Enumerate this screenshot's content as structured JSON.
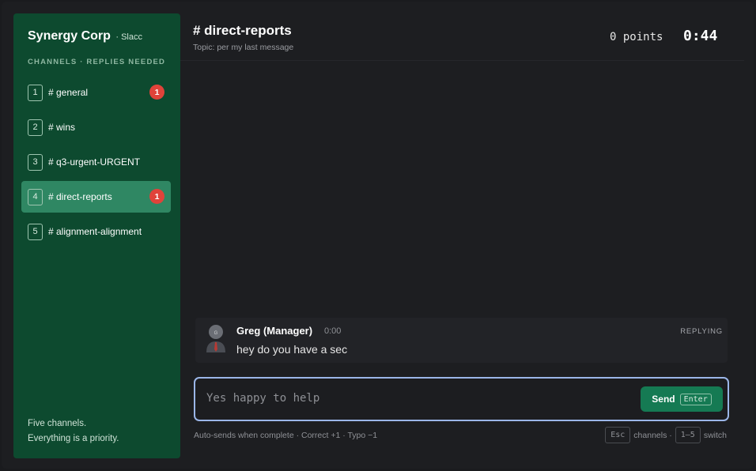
{
  "sidebar": {
    "brand_name": "Synergy Corp",
    "brand_sub": "· Slacc",
    "section_label": "CHANNELS · REPLIES NEEDED",
    "channels": [
      {
        "num": "1",
        "label": "# general",
        "badge": "1"
      },
      {
        "num": "2",
        "label": "# wins",
        "badge": ""
      },
      {
        "num": "3",
        "label": "# q3-urgent-URGENT",
        "badge": ""
      },
      {
        "num": "4",
        "label": "# direct-reports",
        "badge": "1"
      },
      {
        "num": "5",
        "label": "# alignment-alignment",
        "badge": ""
      }
    ],
    "footer_line1": "Five channels.",
    "footer_line2": "Everything is a priority."
  },
  "header": {
    "title": "# direct-reports",
    "topic": "Topic: per my last message",
    "points": "0 points",
    "timer": "0:44"
  },
  "message": {
    "author": "Greg (Manager)",
    "time": "0:00",
    "status": "REPLYING",
    "text": "hey do you have a sec"
  },
  "composer": {
    "value": "Yes happy to help",
    "send_label": "Send",
    "send_key": "Enter"
  },
  "hints": {
    "left": "Auto-sends when complete · Correct +1 · Typo −1",
    "esc_key": "Esc",
    "esc_label": "channels ·",
    "switch_key": "1–5",
    "switch_label": "switch"
  },
  "colors": {
    "sidebar_bg": "#0d4a2f",
    "active_channel": "#2f8763",
    "badge": "#e0433a",
    "send_button": "#157a53",
    "composer_border": "#9bb6e8"
  }
}
